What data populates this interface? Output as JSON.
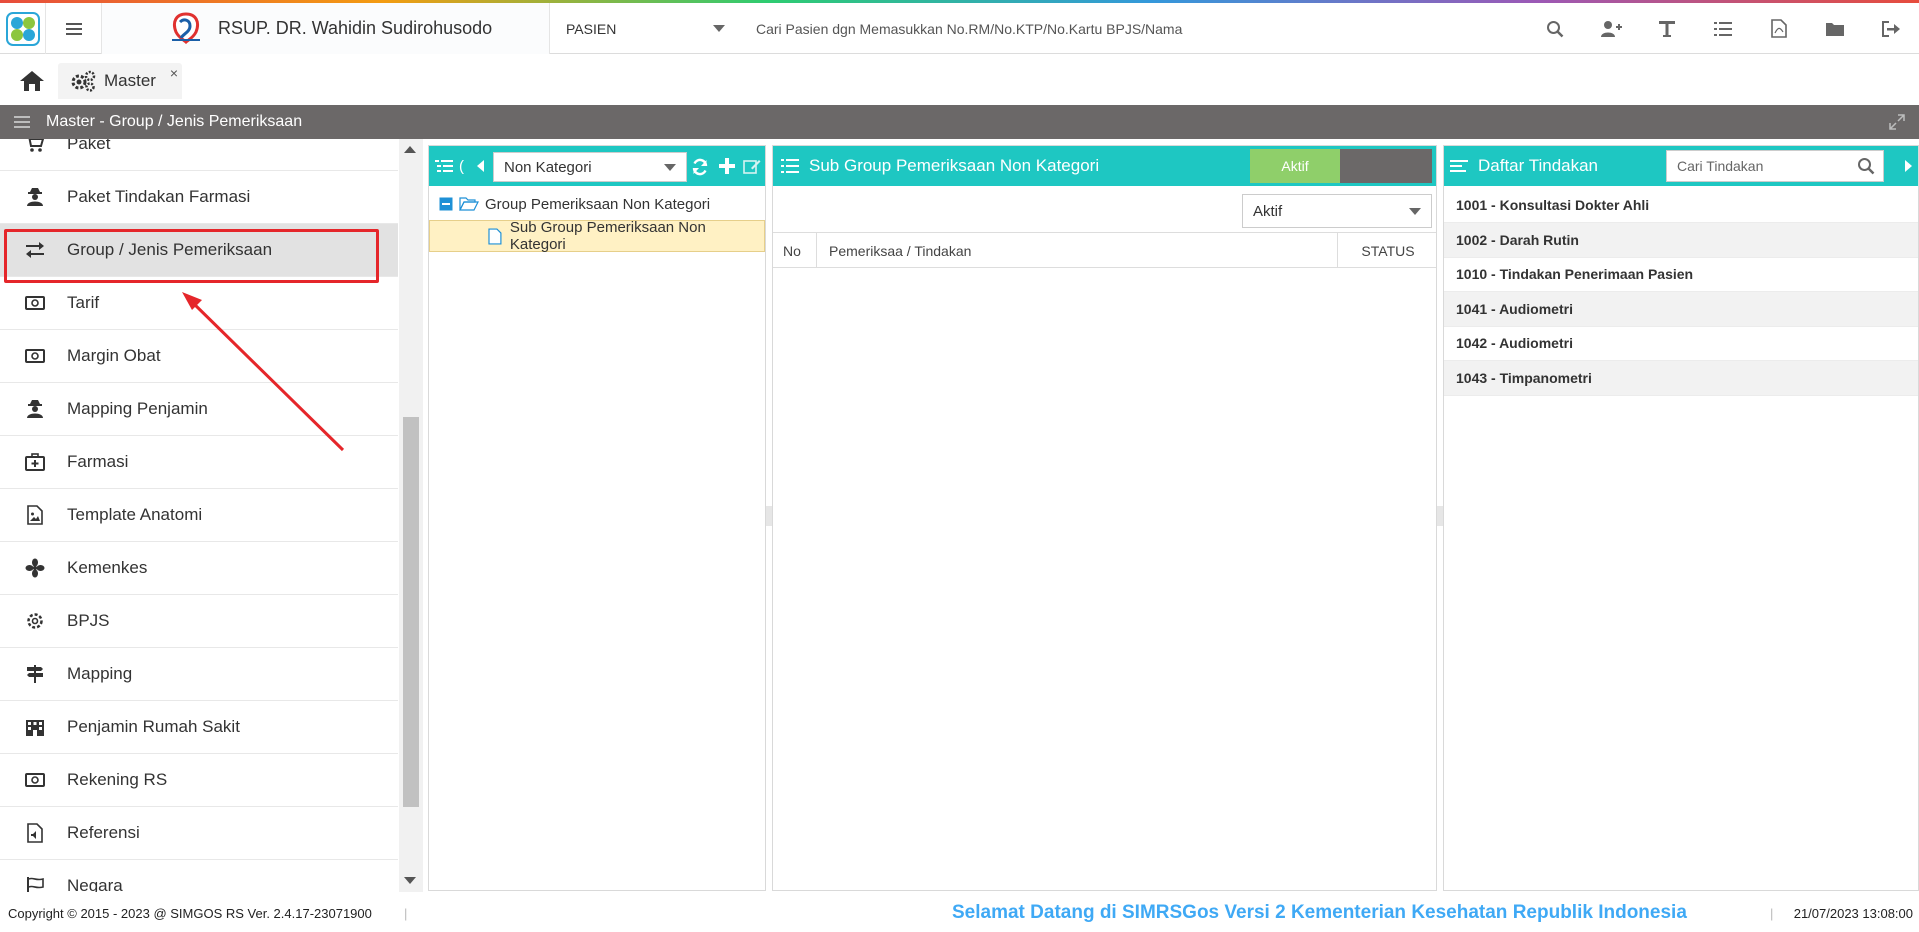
{
  "header": {
    "hospital_name": "RSUP. DR. Wahidin Sudirohusodo",
    "search_scope": "PASIEN",
    "search_placeholder": "Cari Pasien dgn Memasukkan No.RM/No.KTP/No.Kartu BPJS/Nama"
  },
  "tabs": {
    "master_label": "Master",
    "close_glyph": "×"
  },
  "titlebar": {
    "title": "Master - Group / Jenis Pemeriksaan"
  },
  "sidebar": {
    "items": [
      {
        "label": "Paket",
        "icon": "cart-icon"
      },
      {
        "label": "Paket Tindakan Farmasi",
        "icon": "user-secret-icon"
      },
      {
        "label": "Group / Jenis Pemeriksaan",
        "icon": "exchange-icon"
      },
      {
        "label": "Tarif",
        "icon": "money-icon"
      },
      {
        "label": "Margin Obat",
        "icon": "money-icon"
      },
      {
        "label": "Mapping Penjamin",
        "icon": "user-secret-icon"
      },
      {
        "label": "Farmasi",
        "icon": "medkit-icon"
      },
      {
        "label": "Template Anatomi",
        "icon": "file-image-icon"
      },
      {
        "label": "Kemenkes",
        "icon": "fan-icon"
      },
      {
        "label": "BPJS",
        "icon": "gear-icon"
      },
      {
        "label": "Mapping",
        "icon": "signpost-icon"
      },
      {
        "label": "Penjamin Rumah Sakit",
        "icon": "building-icon"
      },
      {
        "label": "Rekening RS",
        "icon": "money-icon"
      },
      {
        "label": "Referensi",
        "icon": "file-audio-icon"
      },
      {
        "label": "Negara",
        "icon": "flag-icon"
      }
    ]
  },
  "group_panel": {
    "header_glyph": "(",
    "category_select": "Non Kategori",
    "tree": {
      "root_label": "Group Pemeriksaan Non Kategori",
      "child_label": "Sub Group Pemeriksaan Non Kategori"
    }
  },
  "sub_group_panel": {
    "title": "Sub Group Pemeriksaan Non Kategori",
    "toggle_label": "Aktif",
    "status_filter": "Aktif",
    "columns": {
      "no": "No",
      "pemeriksaan": "Pemeriksaa / Tindakan",
      "status": "STATUS"
    }
  },
  "tindakan_panel": {
    "title": "Daftar Tindakan",
    "search_placeholder": "Cari Tindakan",
    "items": [
      "1001 - Konsultasi Dokter Ahli",
      "1002 - Darah Rutin",
      "1010 - Tindakan Penerimaan Pasien",
      "1041 - Audiometri",
      "1042 - Audiometri",
      "1043 - Timpanometri"
    ]
  },
  "footer": {
    "copyright": "Copyright © 2015 - 2023 @ SIMGOS RS Ver. 2.4.17-23071900",
    "welcome": "Selamat Datang di SIMRSGos Versi 2 Kementerian Kesehatan Republik Indonesia",
    "datetime": "21/07/2023 13:08:00"
  },
  "colors": {
    "accent": "#1ec7c2",
    "titlebar": "#6b6868",
    "highlight": "#e5262a",
    "welcome": "#3fa9f5"
  }
}
